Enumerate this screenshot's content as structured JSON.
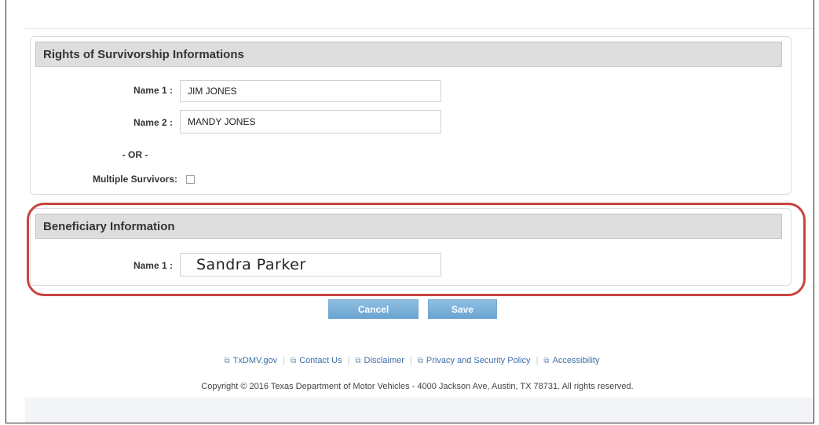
{
  "survivorship": {
    "title": "Rights of Survivorship Informations",
    "name1_label": "Name 1 :",
    "name1_value": "JIM JONES",
    "name2_label": "Name 2 :",
    "name2_value": "MANDY JONES",
    "or_text": "- OR -",
    "multiple_label": "Multiple Survivors:",
    "multiple_checked": false
  },
  "beneficiary": {
    "title": "Beneficiary Information",
    "name1_label": "Name 1 :",
    "name1_value": "Sandra Parker"
  },
  "actions": {
    "cancel_label": "Cancel",
    "save_label": "Save"
  },
  "footer": {
    "links": [
      {
        "label": "TxDMV.gov",
        "icon": "external-link-icon"
      },
      {
        "label": "Contact Us",
        "icon": "external-link-icon"
      },
      {
        "label": "Disclaimer",
        "icon": "external-link-icon"
      },
      {
        "label": "Privacy and Security Policy",
        "icon": "external-link-icon"
      },
      {
        "label": "Accessibility",
        "icon": "external-link-icon"
      }
    ],
    "copyright": "Copyright © 2016 Texas Department of Motor Vehicles - 4000 Jackson Ave, Austin, TX 78731. All rights reserved."
  },
  "colors": {
    "highlight": "#c8443f",
    "button": "#7ab2dc",
    "link": "#3f6fa8"
  }
}
